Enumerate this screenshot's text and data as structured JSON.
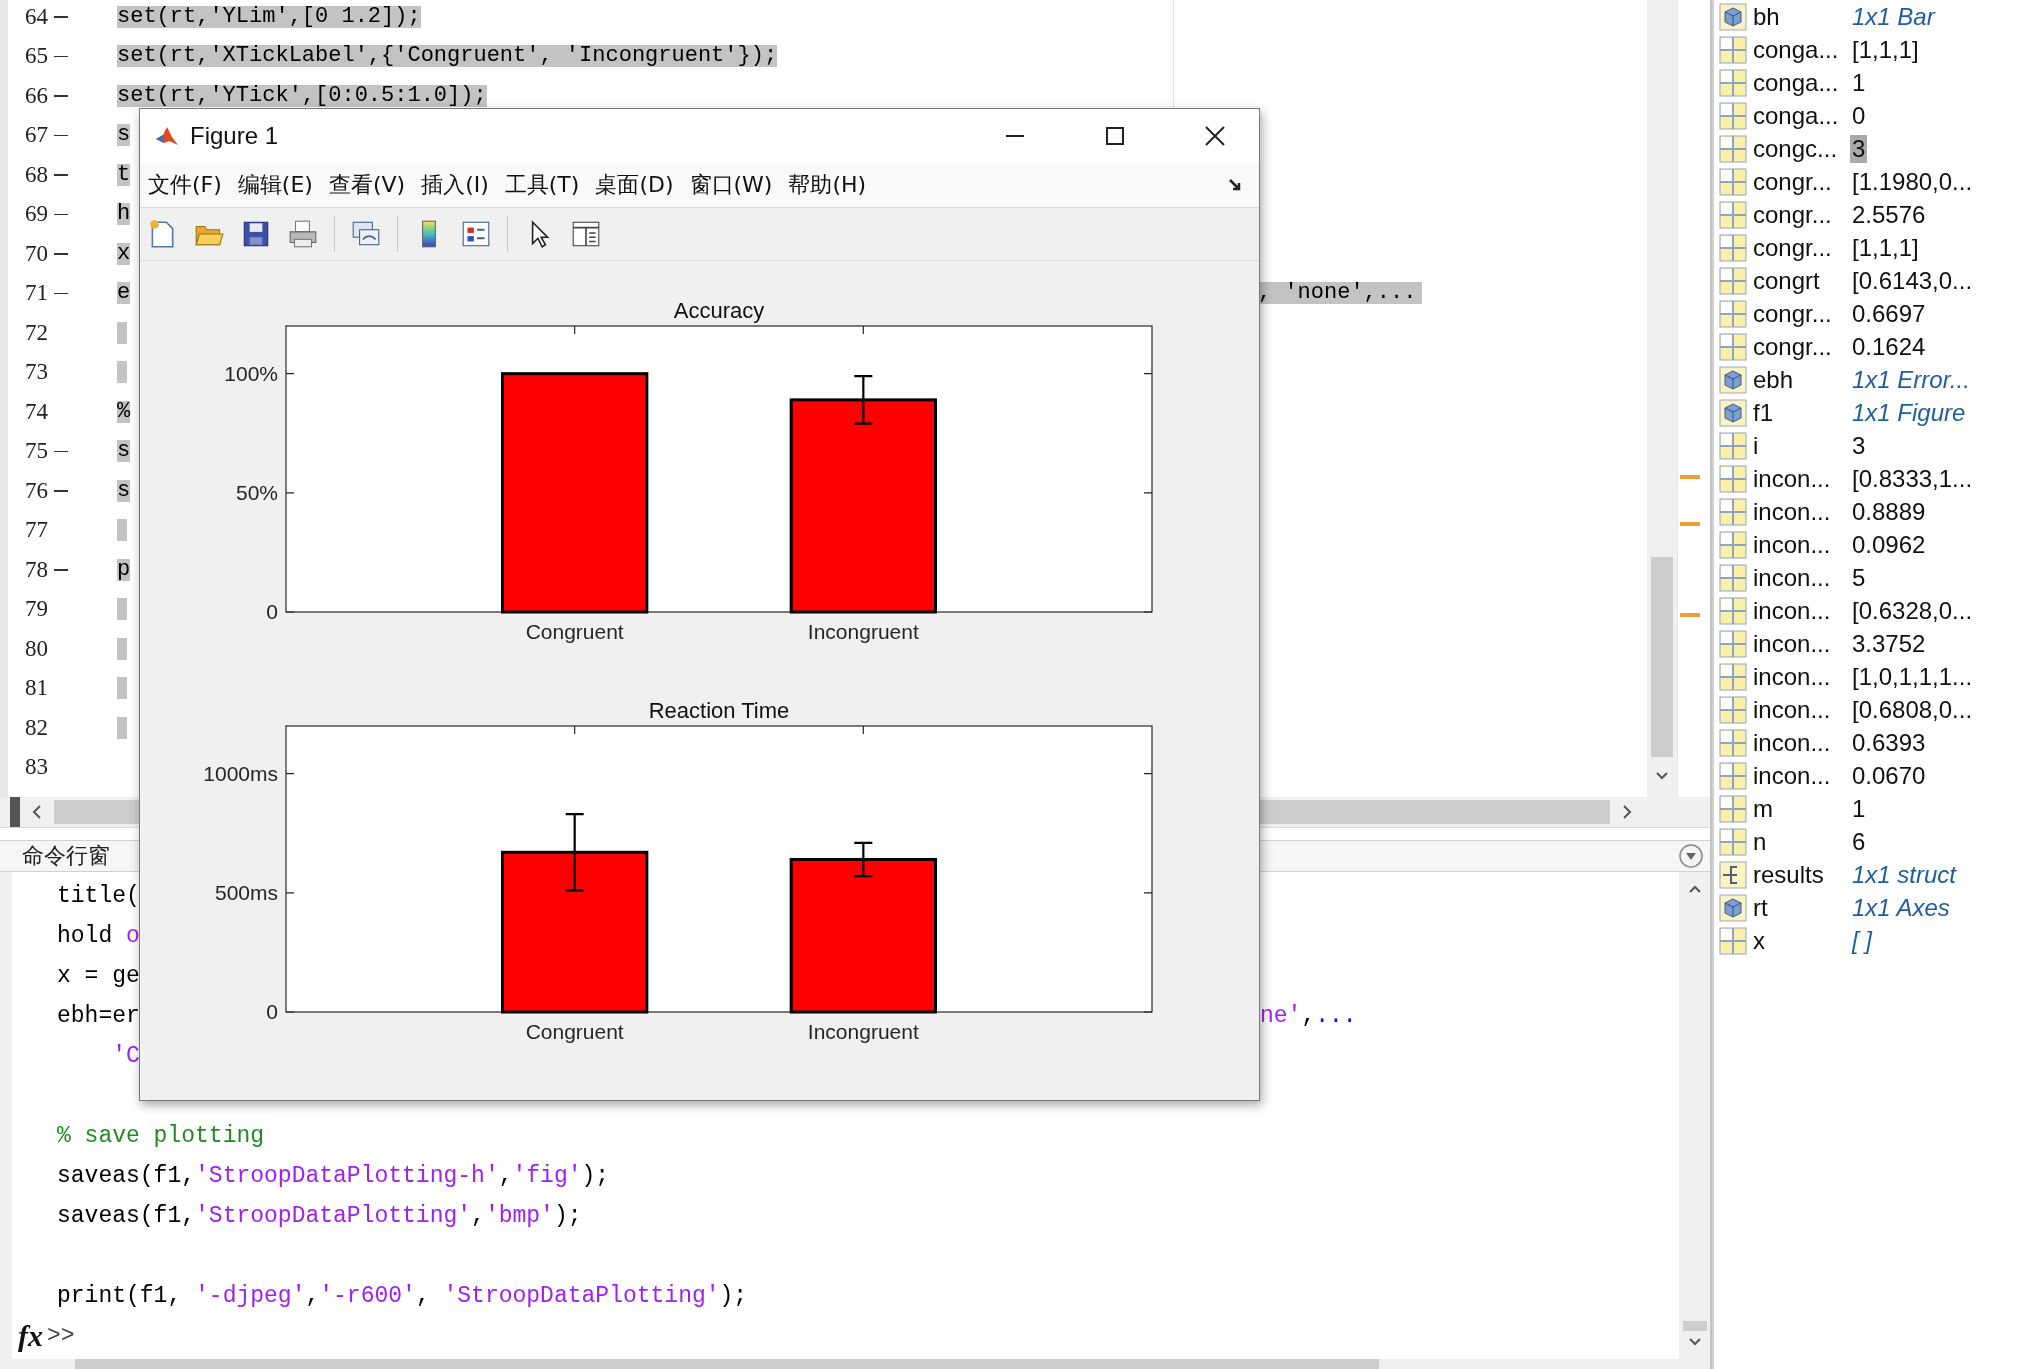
{
  "editor": {
    "lines": [
      {
        "number": "64",
        "executable": true,
        "selected": true,
        "text": "set(rt,'YLim',[0 1.2]);"
      },
      {
        "number": "65",
        "executable": true,
        "selected": true,
        "text": "set(rt,'XTickLabel',{'Congruent', 'Incongruent'});"
      },
      {
        "number": "66",
        "executable": true,
        "selected": true,
        "text": "set(rt,'YTick',[0:0.5:1.0]);"
      },
      {
        "number": "67",
        "executable": true,
        "selected": true,
        "text": "s"
      },
      {
        "number": "68",
        "executable": true,
        "selected": true,
        "text": "t"
      },
      {
        "number": "69",
        "executable": true,
        "selected": true,
        "text": "h"
      },
      {
        "number": "70",
        "executable": true,
        "selected": true,
        "text": "x"
      },
      {
        "number": "71",
        "executable": true,
        "selected": true,
        "text": "e",
        "tail": ", 'none',..."
      },
      {
        "number": "72",
        "executable": false,
        "selected": true
      },
      {
        "number": "73",
        "executable": false,
        "selected": true
      },
      {
        "number": "74",
        "executable": false,
        "selected": true,
        "text": "%"
      },
      {
        "number": "75",
        "executable": true,
        "selected": true,
        "text": "s"
      },
      {
        "number": "76",
        "executable": true,
        "selected": true,
        "text": "s"
      },
      {
        "number": "77",
        "executable": false,
        "selected": true
      },
      {
        "number": "78",
        "executable": true,
        "selected": true,
        "text": "p"
      },
      {
        "number": "79",
        "executable": false,
        "selected": true
      },
      {
        "number": "80",
        "executable": false,
        "selected": true
      },
      {
        "number": "81",
        "executable": false,
        "selected": true
      },
      {
        "number": "82",
        "executable": false,
        "selected": true
      },
      {
        "number": "83",
        "executable": false,
        "selected": false
      }
    ]
  },
  "command_window": {
    "title": "命令行窗",
    "lines": [
      {
        "kind": "code",
        "segments": [
          {
            "text": "title(",
            "kind": "plain"
          }
        ]
      },
      {
        "kind": "code",
        "segments": [
          {
            "text": "hold ",
            "kind": "plain"
          },
          {
            "text": "o",
            "kind": "string"
          }
        ]
      },
      {
        "kind": "code",
        "segments": [
          {
            "text": "x = ge",
            "kind": "plain"
          }
        ]
      },
      {
        "kind": "code",
        "segments": [
          {
            "text": "ebh=er",
            "kind": "plain"
          }
        ],
        "tail": [
          {
            "text": "ne'",
            "kind": "string"
          },
          {
            "text": ",",
            "kind": "plain"
          },
          {
            "text": "...",
            "kind": "continuation"
          }
        ]
      },
      {
        "kind": "code",
        "segments": [
          {
            "text": "    'C",
            "kind": "string"
          }
        ]
      },
      {
        "kind": "blank"
      },
      {
        "kind": "code",
        "segments": [
          {
            "text": "% save plotting",
            "kind": "comment"
          }
        ]
      },
      {
        "kind": "code",
        "segments": [
          {
            "text": "saveas(f1,",
            "kind": "plain"
          },
          {
            "text": "'StroopDataPlotting-h'",
            "kind": "string"
          },
          {
            "text": ",",
            "kind": "plain"
          },
          {
            "text": "'fig'",
            "kind": "string"
          },
          {
            "text": ");",
            "kind": "plain"
          }
        ]
      },
      {
        "kind": "code",
        "segments": [
          {
            "text": "saveas(f1,",
            "kind": "plain"
          },
          {
            "text": "'StroopDataPlotting'",
            "kind": "string"
          },
          {
            "text": ",",
            "kind": "plain"
          },
          {
            "text": "'bmp'",
            "kind": "string"
          },
          {
            "text": ");",
            "kind": "plain"
          }
        ]
      },
      {
        "kind": "blank"
      },
      {
        "kind": "code",
        "segments": [
          {
            "text": "print(f1, ",
            "kind": "plain"
          },
          {
            "text": "'-djpeg'",
            "kind": "string"
          },
          {
            "text": ",",
            "kind": "plain"
          },
          {
            "text": "'-r600'",
            "kind": "string"
          },
          {
            "text": ", ",
            "kind": "plain"
          },
          {
            "text": "'StroopDataPlotting'",
            "kind": "string"
          },
          {
            "text": ");",
            "kind": "plain"
          }
        ]
      }
    ],
    "prompt_icon": "fx",
    "prompt": ">>"
  },
  "workspace": {
    "rows": [
      {
        "kind": "object",
        "name": "bh",
        "value": "1x1 Bar",
        "highlighted": false
      },
      {
        "kind": "matrix",
        "name": "conga...",
        "value": "[1,1,1]",
        "highlighted": false
      },
      {
        "kind": "matrix",
        "name": "conga...",
        "value": "1",
        "highlighted": false
      },
      {
        "kind": "matrix",
        "name": "conga...",
        "value": "0",
        "highlighted": false
      },
      {
        "kind": "matrix",
        "name": "congc...",
        "value": "3",
        "highlighted": true
      },
      {
        "kind": "matrix",
        "name": "congr...",
        "value": "[1.1980,0...",
        "highlighted": false
      },
      {
        "kind": "matrix",
        "name": "congr...",
        "value": "2.5576",
        "highlighted": false
      },
      {
        "kind": "matrix",
        "name": "congr...",
        "value": "[1,1,1]",
        "highlighted": false
      },
      {
        "kind": "matrix",
        "name": "congrt",
        "value": "[0.6143,0...",
        "highlighted": false
      },
      {
        "kind": "matrix",
        "name": "congr...",
        "value": "0.6697",
        "highlighted": false
      },
      {
        "kind": "matrix",
        "name": "congr...",
        "value": "0.1624",
        "highlighted": false
      },
      {
        "kind": "object",
        "name": "ebh",
        "value": "1x1 Error...",
        "highlighted": false
      },
      {
        "kind": "object",
        "name": "f1",
        "value": "1x1 Figure",
        "highlighted": false
      },
      {
        "kind": "matrix",
        "name": "i",
        "value": "3",
        "highlighted": false
      },
      {
        "kind": "matrix",
        "name": "incon...",
        "value": "[0.8333,1...",
        "highlighted": false
      },
      {
        "kind": "matrix",
        "name": "incon...",
        "value": "0.8889",
        "highlighted": false
      },
      {
        "kind": "matrix",
        "name": "incon...",
        "value": "0.0962",
        "highlighted": false
      },
      {
        "kind": "matrix",
        "name": "incon...",
        "value": "5",
        "highlighted": false
      },
      {
        "kind": "matrix",
        "name": "incon...",
        "value": "[0.6328,0...",
        "highlighted": false
      },
      {
        "kind": "matrix",
        "name": "incon...",
        "value": "3.3752",
        "highlighted": false
      },
      {
        "kind": "matrix",
        "name": "incon...",
        "value": "[1,0,1,1,1...",
        "highlighted": false
      },
      {
        "kind": "matrix",
        "name": "incon...",
        "value": "[0.6808,0...",
        "highlighted": false
      },
      {
        "kind": "matrix",
        "name": "incon...",
        "value": "0.6393",
        "highlighted": false
      },
      {
        "kind": "matrix",
        "name": "incon...",
        "value": "0.0670",
        "highlighted": false
      },
      {
        "kind": "matrix",
        "name": "m",
        "value": "1",
        "highlighted": false
      },
      {
        "kind": "matrix",
        "name": "n",
        "value": "6",
        "highlighted": false
      },
      {
        "kind": "struct",
        "name": "results",
        "value": "1x1 struct",
        "highlighted": false
      },
      {
        "kind": "object",
        "name": "rt",
        "value": "1x1 Axes",
        "highlighted": false
      },
      {
        "kind": "empty",
        "name": "x",
        "value": "[ ]",
        "highlighted": false
      }
    ]
  },
  "figure_window": {
    "title": "Figure 1",
    "menu": [
      "文件(F)",
      "编辑(E)",
      "查看(V)",
      "插入(I)",
      "工具(T)",
      "桌面(D)",
      "窗口(W)",
      "帮助(H)"
    ],
    "toolbar": [
      {
        "kind": "new"
      },
      {
        "kind": "open"
      },
      {
        "kind": "save"
      },
      {
        "kind": "print"
      },
      {
        "kind": "separator"
      },
      {
        "kind": "link"
      },
      {
        "kind": "separator"
      },
      {
        "kind": "colorbar"
      },
      {
        "kind": "legend"
      },
      {
        "kind": "separator"
      },
      {
        "kind": "pointer"
      },
      {
        "kind": "property"
      }
    ],
    "charts": [
      {
        "chart_data": {
          "type": "bar",
          "title": "Accuracy",
          "categories": [
            "Congruent",
            "Incongruent"
          ],
          "values": [
            100,
            89
          ],
          "errors": [
            null,
            10
          ],
          "ylim": [
            0,
            120
          ],
          "yticks": [
            {
              "value": 0,
              "label": "0"
            },
            {
              "value": 50,
              "label": "50%"
            },
            {
              "value": 100,
              "label": "100%"
            }
          ]
        }
      },
      {
        "chart_data": {
          "type": "bar",
          "title": "Reaction Time",
          "categories": [
            "Congruent",
            "Incongruent"
          ],
          "values": [
            670,
            640
          ],
          "errors": [
            160,
            70
          ],
          "ylim": [
            0,
            1200
          ],
          "yticks": [
            {
              "value": 0,
              "label": "0"
            },
            {
              "value": 500,
              "label": "500ms"
            },
            {
              "value": 1000,
              "label": "1000ms"
            }
          ]
        }
      }
    ]
  }
}
